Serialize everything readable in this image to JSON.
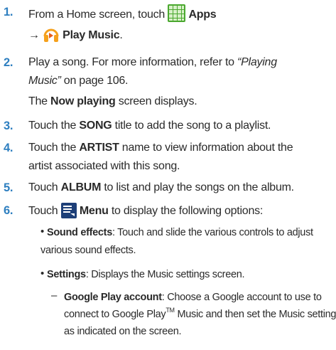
{
  "steps": [
    {
      "number": "1.",
      "line1": {
        "text": "From a Home screen, touch",
        "apps": "Apps"
      },
      "line2": {
        "arrow": "→",
        "play_music": "Play Music",
        "period": "."
      }
    },
    {
      "number": "2.",
      "line1": "Play a song. For more information, refer to",
      "ref_quoted": "“Playing",
      "ref_quoted2": "Music”",
      "page_ref": " on page 106.",
      "sub_bold": "Now playing",
      "sub_pre": "The ",
      "sub_post": " screen displays."
    },
    {
      "number": "3.",
      "pre": "Touch the ",
      "bold": "SONG",
      "post": " title to add the song to a playlist."
    },
    {
      "number": "4.",
      "pre": "Touch the ",
      "bold": "ARTIST",
      "post": " name to view information about the",
      "line2": "artist associated with this song."
    },
    {
      "number": "5.",
      "pre": "Touch ",
      "bold": "ALBUM",
      "post": " to list and play the songs on the album."
    },
    {
      "number": "6.",
      "pre": "Touch ",
      "bold": "Menu",
      "post": " to display the following options:"
    }
  ],
  "options": [
    {
      "bullet": "•",
      "label": "Sound effects",
      "text": ": Touch and slide the various controls to adjust",
      "line2": "various sound effects."
    },
    {
      "bullet": "•",
      "label": "Settings",
      "text": ": Displays the Music settings screen."
    }
  ],
  "suboption": {
    "dash": "–",
    "label": "Google Play account",
    "text": ": Choose a Google account to use to",
    "line2_pre": "connect to Google Play",
    "tm": "TM",
    "line2_post": " Music and then set the Music settings",
    "line3": "as indicated on the screen."
  },
  "icons": {
    "apps": "apps-grid-icon",
    "play_music": "headphones-icon",
    "menu": "menu-icon"
  },
  "colors": {
    "step_number": "#2e7fc0",
    "apps_green": "#4aa82f",
    "music_orange": "#f5a11c"
  }
}
